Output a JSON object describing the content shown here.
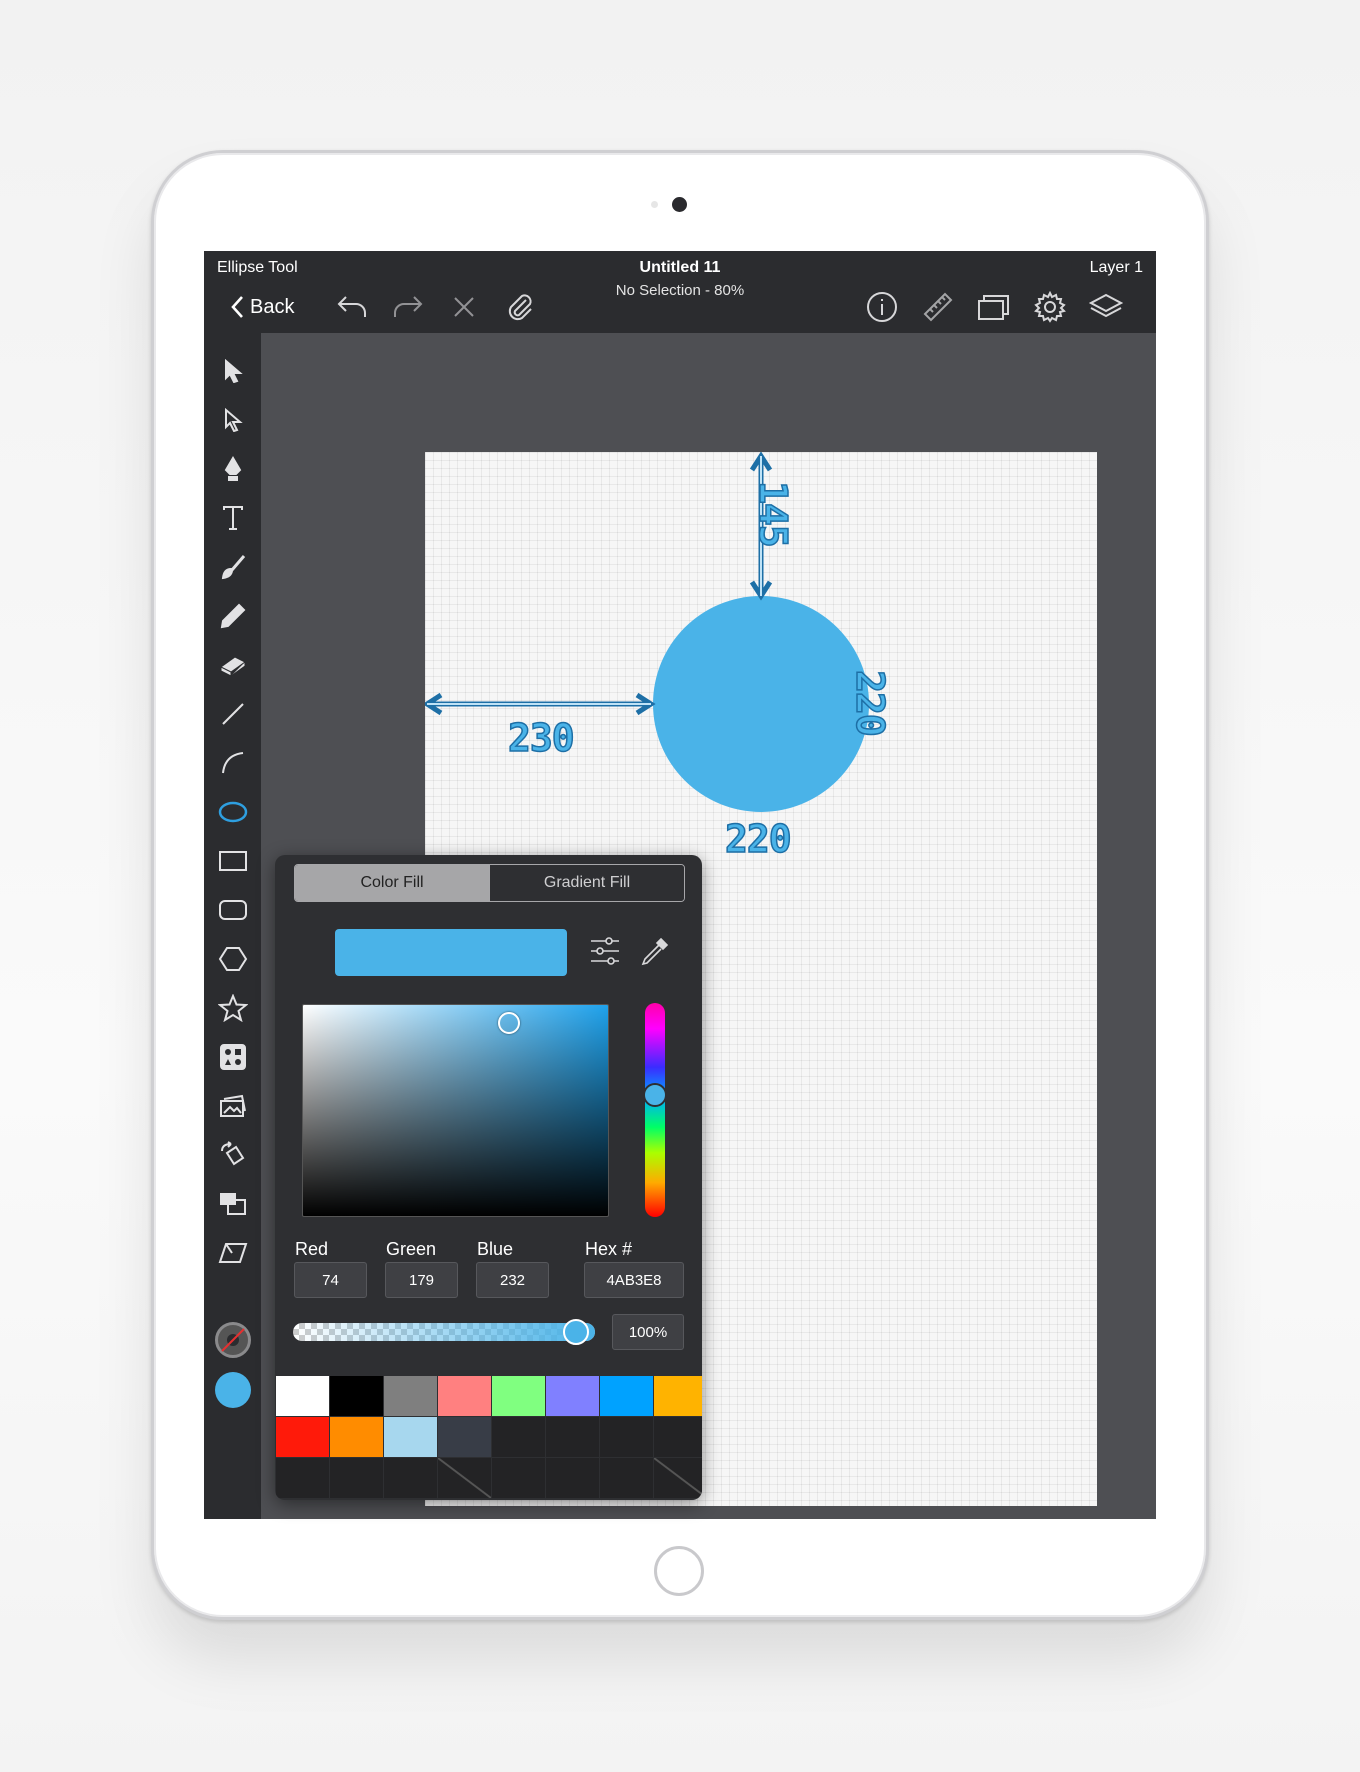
{
  "header": {
    "tool_name": "Ellipse Tool",
    "doc_title": "Untitled 11",
    "doc_subtitle": "No Selection - 80%",
    "layer_name": "Layer 1",
    "back_label": "Back",
    "left_buttons": [
      "undo-icon",
      "redo-icon",
      "delete-icon",
      "paperclip-icon"
    ],
    "right_buttons": [
      "info-icon",
      "ruler-icon",
      "artboards-icon",
      "settings-icon",
      "layers-icon"
    ]
  },
  "tools": [
    "selection-arrow-icon",
    "direct-selection-icon",
    "pen-icon",
    "text-icon",
    "brush-icon",
    "pencil-icon",
    "eraser-icon",
    "line-icon",
    "arc-icon",
    "ellipse-icon",
    "rectangle-icon",
    "rounded-rectangle-icon",
    "polygon-icon",
    "star-icon",
    "shapes-icon",
    "image-icon",
    "transform-icon",
    "arrange-icon",
    "skew-icon"
  ],
  "active_tool": "ellipse-icon",
  "canvas": {
    "dimension_top": "145",
    "dimension_left": "230",
    "dimension_right": "220",
    "dimension_bottom": "220",
    "shape_color": "#4AB3E8"
  },
  "color_panel": {
    "tab_color_fill": "Color Fill",
    "tab_gradient_fill": "Gradient Fill",
    "active_tab": "Color Fill",
    "preview_color": "#4AB3E8",
    "labels": {
      "red": "Red",
      "green": "Green",
      "blue": "Blue",
      "hex": "Hex #"
    },
    "values": {
      "red": "74",
      "green": "179",
      "blue": "232",
      "hex": "4AB3E8"
    },
    "opacity": "100%",
    "opacity_fraction": 1.0,
    "saturation_fraction": 0.68,
    "brightness_fraction": 0.91,
    "hue_fraction": 0.43,
    "palette": [
      "#FFFFFF",
      "#000000",
      "#7F7F7F",
      "#FF8080",
      "#80FF80",
      "#8080FF",
      "#00A2FF",
      "#FFB300",
      "#FF1A0A",
      "#FF8C00",
      "#A7D7EE",
      "#383D47",
      "#232325",
      "#232325",
      "#232325",
      "#232325",
      "#232325",
      "#232325",
      "#232325",
      "#232325",
      "#232325",
      "#232325",
      "#232325",
      "#232325"
    ]
  },
  "stroke_swatch_color": "#555555",
  "fill_swatch_color": "#4AB3E8"
}
